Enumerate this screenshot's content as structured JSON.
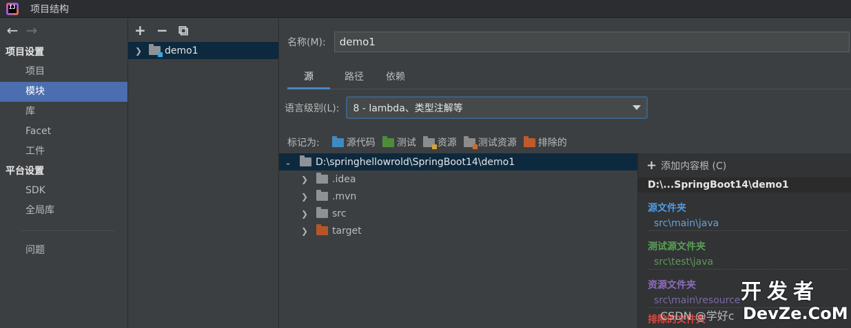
{
  "window": {
    "title": "项目结构",
    "logo_text": "IJ"
  },
  "nav": {
    "back_glyph": "←",
    "forward_glyph": "→",
    "project_settings_header": "项目设置",
    "project_settings_items": [
      "项目",
      "模块",
      "库",
      "Facet",
      "工件"
    ],
    "platform_settings_header": "平台设置",
    "platform_settings_items": [
      "SDK",
      "全局库"
    ],
    "problems_label": "问题"
  },
  "modules": {
    "toolbar": {
      "add": "+",
      "remove": "−",
      "copy": "⧉"
    },
    "items": [
      "demo1"
    ]
  },
  "module_detail": {
    "name_label": "名称(M):",
    "name_value": "demo1",
    "tabs": [
      "源",
      "路径",
      "依赖"
    ],
    "language_level_label": "语言级别(L):",
    "language_level_value": "8 - lambda、类型注解等",
    "mark_as_label": "标记为:",
    "mark_as": [
      {
        "label": "源代码",
        "icon": "source-folder-icon"
      },
      {
        "label": "测试",
        "icon": "test-folder-icon"
      },
      {
        "label": "资源",
        "icon": "resource-folder-icon"
      },
      {
        "label": "测试资源",
        "icon": "test-resource-folder-icon"
      },
      {
        "label": "排除的",
        "icon": "excluded-folder-icon"
      }
    ],
    "tree": {
      "root": "D:\\springhellowrold\\SpringBoot14\\demo1",
      "children": [
        ".idea",
        ".mvn",
        "src",
        "target"
      ]
    },
    "content_root_panel": {
      "add_label": "添加内容根 (C)",
      "root_header": "D:\\...SpringBoot14\\demo1",
      "source_header": "源文件夹",
      "source_path": "src\\main\\java",
      "test_header": "测试源文件夹",
      "test_path": "src\\test\\java",
      "resource_header": "资源文件夹",
      "resource_path": "src\\main\\resource",
      "excluded_header": "排除的文件夹"
    }
  },
  "watermarks": {
    "csdn": "CSDN @学好c",
    "devze_top": "开发者",
    "devze_bottom": "DevZe.CoM"
  },
  "colors": {
    "selected": "#4b6eaf",
    "tab_underline": "#4a88c7",
    "source": "#4f9ae0",
    "test": "#5aa055",
    "resource": "#8f6bbd",
    "excluded": "#e0463e"
  }
}
